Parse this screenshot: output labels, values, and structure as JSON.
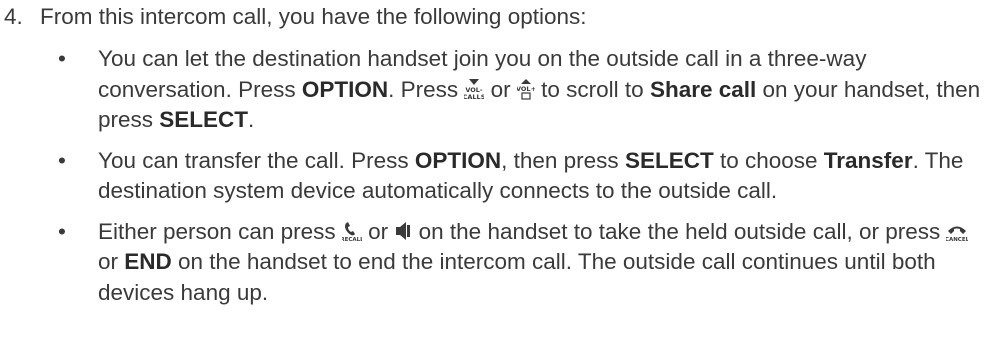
{
  "step": {
    "number": "4.",
    "text": "From this intercom call, you have the following options:"
  },
  "bullet_char": "•",
  "bullet1": {
    "t1": "You can let the destination handset join you on the outside call in a three-way conversation. Press ",
    "b1": "OPTION",
    "t2": ". Press ",
    "icon1": "vol-down-calls-key-icon",
    "t3": " or ",
    "icon2": "vol-up-key-icon",
    "t4": " to scroll to ",
    "b2": "Share call",
    "t5": " on your handset, then press ",
    "b3": "SELECT",
    "t6": "."
  },
  "bullet2": {
    "t1": "You can transfer the call. Press ",
    "b1": "OPTION",
    "t2": ", then press ",
    "b2": "SELECT",
    "t3": " to choose ",
    "b3": "Transfer",
    "t4": ". The destination system device automatically connects to the outside call."
  },
  "bullet3": {
    "t1": "Either person can press ",
    "icon1": "talk-recall-key-icon",
    "t2": " or ",
    "icon2": "speaker-key-icon",
    "t3": " on the handset to take the held outside call, or press ",
    "icon3": "off-cancel-key-icon",
    "t4": " or ",
    "b1": "END",
    "t5": " on the handset to end the intercom call. The outside call continues until both devices hang up."
  }
}
